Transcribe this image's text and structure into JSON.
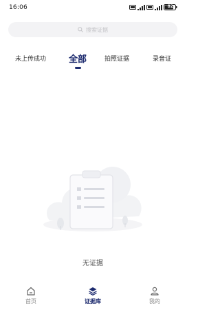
{
  "status_bar": {
    "time": "16:06",
    "battery": "82"
  },
  "search": {
    "placeholder": "搜索证据",
    "icon": "search-icon"
  },
  "tabs": [
    {
      "label": "未上传成功",
      "active": false
    },
    {
      "label": "全部",
      "active": true
    },
    {
      "label": "拍照证据",
      "active": false
    },
    {
      "label": "录音证",
      "active": false
    }
  ],
  "empty_state": {
    "text": "无证据",
    "icon": "clipboard-icon"
  },
  "bottom_nav": [
    {
      "label": "首页",
      "icon": "home-icon",
      "active": false
    },
    {
      "label": "证据库",
      "icon": "layers-icon",
      "active": true
    },
    {
      "label": "我的",
      "icon": "user-icon",
      "active": false
    }
  ],
  "colors": {
    "accent": "#1c2a6e",
    "search_bg": "#f3f3f5",
    "muted_text": "#888888"
  }
}
